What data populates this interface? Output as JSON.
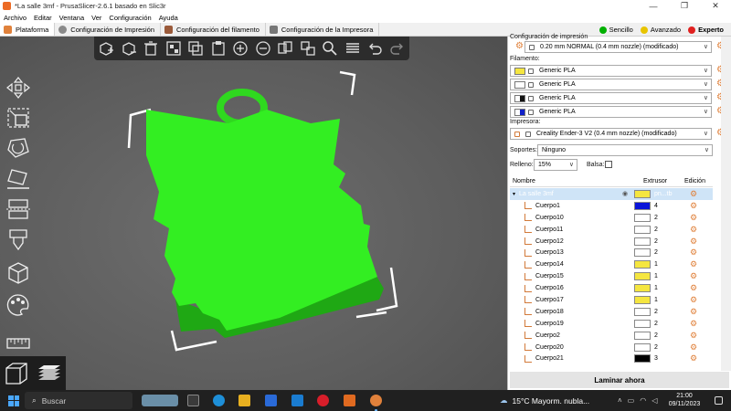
{
  "window": {
    "title": "*La salle 3mf - PrusaSlicer-2.6.1 basado en Slic3r",
    "minimize": "—",
    "maximize": "❐",
    "close": "✕"
  },
  "menu": [
    "Archivo",
    "Editar",
    "Ventana",
    "Ver",
    "Configuración",
    "Ayuda"
  ],
  "tabs": [
    {
      "label": "Plataforma",
      "active": true
    },
    {
      "label": "Configuración de Impresión",
      "active": false
    },
    {
      "label": "Configuración del filamento",
      "active": false
    },
    {
      "label": "Configuración de la Impresora",
      "active": false
    }
  ],
  "modes": [
    {
      "label": "Sencillo",
      "color": "#00b000",
      "active": false
    },
    {
      "label": "Avanzado",
      "color": "#e8c400",
      "active": false
    },
    {
      "label": "Experto",
      "color": "#e0201f",
      "active": true
    }
  ],
  "colors": {
    "model_green": "#33ee22",
    "accent_orange": "#e0813b",
    "bed_bg": "#5f5f5f",
    "toolbar_bg": "#2c2c2c"
  },
  "panel": {
    "print_settings_label": "Configuración de impresión",
    "print_profile": "0.20 mm NORMAL (0.4 mm nozzle) (modificado)",
    "filament_label": "Filamento:",
    "filaments": [
      {
        "name": "Generic PLA",
        "color": "#f5e640"
      },
      {
        "name": "Generic PLA",
        "color": "#ffffff"
      },
      {
        "name": "Generic PLA",
        "color": "#111111"
      },
      {
        "name": "Generic PLA",
        "color": "#1020c8"
      }
    ],
    "printer_label": "Impresora:",
    "printer_profile": "Creality Ender-3 V2 (0.4 mm nozzle) (modificado)",
    "supports_label": "Soportes:",
    "supports_value": "Ninguno",
    "infill_label": "Relleno:",
    "infill_value": "15%",
    "brim_label": "Balsa:",
    "columns": {
      "name": "Nombre",
      "extruder": "Extrusor",
      "edit": "Edición"
    },
    "object": {
      "name": "La salle 3mf",
      "extruder": "pn...tb"
    },
    "parts": [
      {
        "name": "Cuerpo1",
        "extruder": "4",
        "color": "#0a14d8"
      },
      {
        "name": "Cuerpo10",
        "extruder": "2",
        "color": "#ffffff"
      },
      {
        "name": "Cuerpo11",
        "extruder": "2",
        "color": "#ffffff"
      },
      {
        "name": "Cuerpo12",
        "extruder": "2",
        "color": "#ffffff"
      },
      {
        "name": "Cuerpo13",
        "extruder": "2",
        "color": "#ffffff"
      },
      {
        "name": "Cuerpo14",
        "extruder": "1",
        "color": "#f5e640"
      },
      {
        "name": "Cuerpo15",
        "extruder": "1",
        "color": "#f5e640"
      },
      {
        "name": "Cuerpo16",
        "extruder": "1",
        "color": "#f5e640"
      },
      {
        "name": "Cuerpo17",
        "extruder": "1",
        "color": "#f5e640"
      },
      {
        "name": "Cuerpo18",
        "extruder": "2",
        "color": "#ffffff"
      },
      {
        "name": "Cuerpo19",
        "extruder": "2",
        "color": "#ffffff"
      },
      {
        "name": "Cuerpo2",
        "extruder": "2",
        "color": "#ffffff"
      },
      {
        "name": "Cuerpo20",
        "extruder": "2",
        "color": "#ffffff"
      },
      {
        "name": "Cuerpo21",
        "extruder": "3",
        "color": "#000000"
      }
    ],
    "slice_button": "Laminar ahora"
  },
  "taskbar": {
    "search_placeholder": "Buscar",
    "weather": "15°C  Mayorm. nubla...",
    "time": "21:00",
    "date": "09/11/2023"
  }
}
